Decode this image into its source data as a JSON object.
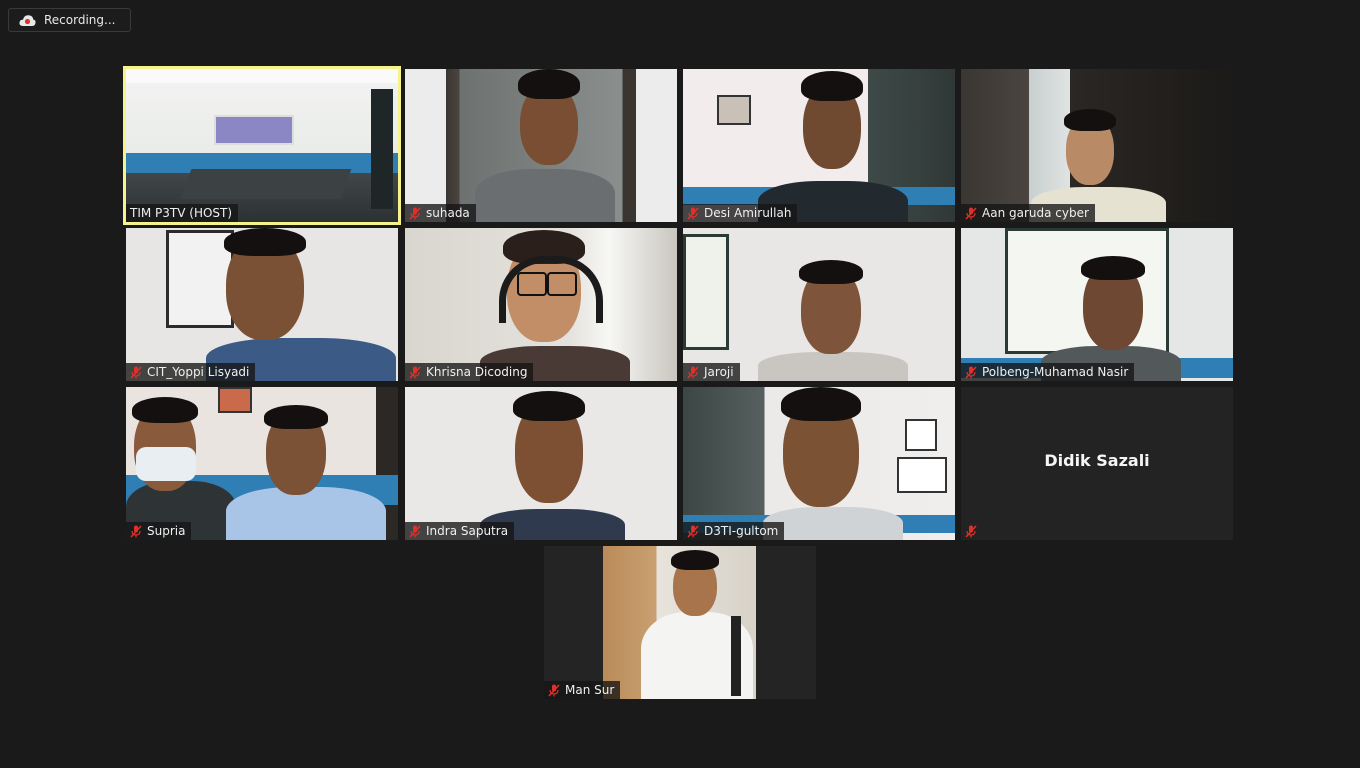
{
  "recording": {
    "label": "Recording...",
    "icon": "cloud-record-icon"
  },
  "participants": [
    {
      "name": "TIM P3TV (HOST)",
      "muted": false,
      "active_speaker": true
    },
    {
      "name": "suhada",
      "muted": true
    },
    {
      "name": "Desi Amirullah",
      "muted": true
    },
    {
      "name": "Aan garuda cyber",
      "muted": true
    },
    {
      "name": "CIT_Yoppi Lisyadi",
      "muted": true
    },
    {
      "name": "Khrisna Dicoding",
      "muted": true
    },
    {
      "name": "Jaroji",
      "muted": true
    },
    {
      "name": "Polbeng-Muhamad Nasir",
      "muted": true
    },
    {
      "name": "Supria",
      "muted": true
    },
    {
      "name": "Indra Saputra",
      "muted": true
    },
    {
      "name": "D3TI-gultom",
      "muted": true
    },
    {
      "name": "",
      "display_name": "Didik Sazali",
      "muted": true,
      "video_off": true
    },
    {
      "name": "Man Sur",
      "muted": true
    }
  ],
  "colors": {
    "active_border": "#f5f38a",
    "mute_icon": "#e0302a",
    "background": "#1a1a1a"
  }
}
